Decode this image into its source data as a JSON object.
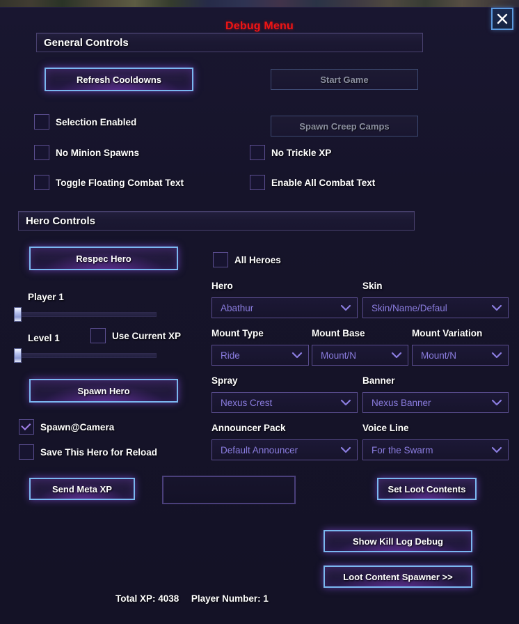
{
  "window": {
    "title": "Debug Menu",
    "close_label": "X"
  },
  "colors": {
    "title_red": "#f01414",
    "active_border_blue": "#7ab8f0",
    "glow_purple": "#8250dc",
    "dropdown_text": "#8b7de0",
    "panel_bg": "#16142a"
  },
  "general_controls": {
    "header": "General Controls",
    "buttons": {
      "refresh_cooldowns": "Refresh Cooldowns",
      "start_game": "Start Game",
      "spawn_creep_camps": "Spawn Creep Camps"
    },
    "checkboxes": [
      {
        "label": "Selection Enabled",
        "checked": false
      },
      {
        "label": "No Minion Spawns",
        "checked": false
      },
      {
        "label": "No Trickle XP",
        "checked": false
      },
      {
        "label": "Toggle Floating Combat Text",
        "checked": false
      },
      {
        "label": "Enable All Combat Text",
        "checked": false
      }
    ]
  },
  "hero_controls": {
    "header": "Hero Controls",
    "buttons": {
      "respec_hero": "Respec Hero",
      "spawn_hero": "Spawn Hero"
    },
    "all_heroes": {
      "label": "All Heroes",
      "checked": false
    },
    "player_slider": {
      "label": "Player 1",
      "value": 1
    },
    "level_slider": {
      "label": "Level 1",
      "value": 1
    },
    "use_current_xp": {
      "label": "Use Current XP",
      "checked": false
    },
    "spawn_at_camera": {
      "label": "Spawn@Camera",
      "checked": true
    },
    "save_hero_for_reload": {
      "label": "Save This Hero for Reload",
      "checked": false
    },
    "dropdowns": [
      {
        "label": "Hero",
        "value": "Abathur"
      },
      {
        "label": "Skin",
        "value": "Skin/Name/Defaul"
      },
      {
        "label": "Mount Type",
        "value": "Ride"
      },
      {
        "label": "Mount Base",
        "value": "Mount/N"
      },
      {
        "label": "Mount Variation",
        "value": "Mount/N"
      },
      {
        "label": "Spray",
        "value": "Nexus Crest"
      },
      {
        "label": "Banner",
        "value": "Nexus Banner"
      },
      {
        "label": "Announcer Pack",
        "value": "Default Announcer"
      },
      {
        "label": "Voice Line",
        "value": "For the Swarm"
      }
    ]
  },
  "footer": {
    "buttons": {
      "send_meta_xp": "Send Meta XP",
      "set_loot_contents": "Set Loot Contents",
      "show_kill_log_debug": "Show Kill Log Debug",
      "loot_content_spawner": "Loot Content Spawner >>"
    },
    "xp_input": {
      "value": "",
      "placeholder": ""
    },
    "status": {
      "total_xp_label": "Total XP: 4038",
      "player_number_label": "Player Number: 1"
    }
  }
}
